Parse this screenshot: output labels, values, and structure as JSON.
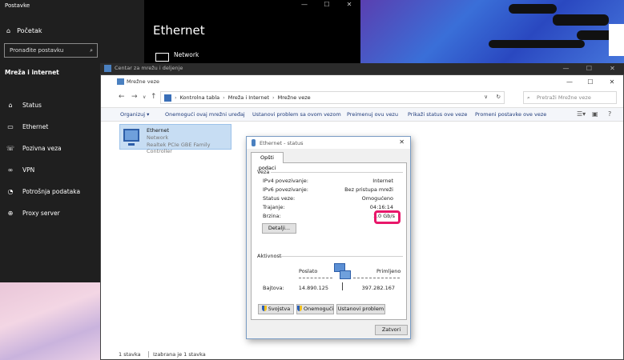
{
  "settings": {
    "title": "Postavke",
    "home_label": "Početak",
    "search_placeholder": "Pronađite postavku",
    "section": "Mreža i internet",
    "nav": [
      {
        "label": "Status",
        "icon": "home-status-icon"
      },
      {
        "label": "Ethernet",
        "icon": "ethernet-icon"
      },
      {
        "label": "Pozivna veza",
        "icon": "phone-icon"
      },
      {
        "label": "VPN",
        "icon": "vpn-icon"
      },
      {
        "label": "Potrošnja podataka",
        "icon": "data-usage-icon"
      },
      {
        "label": "Proxy server",
        "icon": "globe-icon"
      }
    ]
  },
  "ethernet_settings": {
    "heading": "Ethernet",
    "network_label": "Network"
  },
  "center_window": {
    "title": "Centar za mrežu i deljenje"
  },
  "explorer": {
    "title": "Mrežne veze",
    "breadcrumb": [
      "Kontrolna tabla",
      "Mreža i Internet",
      "Mrežne veze"
    ],
    "search_placeholder": "Pretraži Mrežne veze",
    "commands": [
      "Organizuj ▾",
      "Onemogući ovaj mrežni uređaj",
      "Ustanovi problem sa ovom vezom",
      "Preimenuj ovu vezu",
      "Prikaži status ove veze",
      "Promeni postavke ove veze"
    ],
    "adapter": {
      "name": "Ethernet",
      "network": "Network",
      "device": "Realtek PCIe GBE Family Controller"
    },
    "status_count": "1 stavka",
    "status_selected": "Izabrana je 1 stavka"
  },
  "dialog": {
    "title": "Ethernet - status",
    "tab": "Opšti podaci",
    "group_connection": "Veza",
    "rows": [
      {
        "label": "IPv4 povezivanje:",
        "value": "Internet"
      },
      {
        "label": "IPv6 povezivanje:",
        "value": "Bez pristupa mreži"
      },
      {
        "label": "Status veze:",
        "value": "Omogućeno"
      },
      {
        "label": "Trajanje:",
        "value": "04:16:14"
      },
      {
        "label": "Brzina:",
        "value": "1.0 Gb/s"
      }
    ],
    "details_button": "Detalji...",
    "group_activity": "Aktivnost",
    "sent_label": "Poslato",
    "received_label": "Primljeno",
    "bytes_label": "Bajtova:",
    "bytes_sent": "14.890.125",
    "bytes_received": "397.282.167",
    "btn_properties": "Svojstva",
    "btn_disable": "Onemogući",
    "btn_diagnose": "Ustanovi problem",
    "btn_close": "Zatvori",
    "highlight_color": "#e8176a"
  }
}
